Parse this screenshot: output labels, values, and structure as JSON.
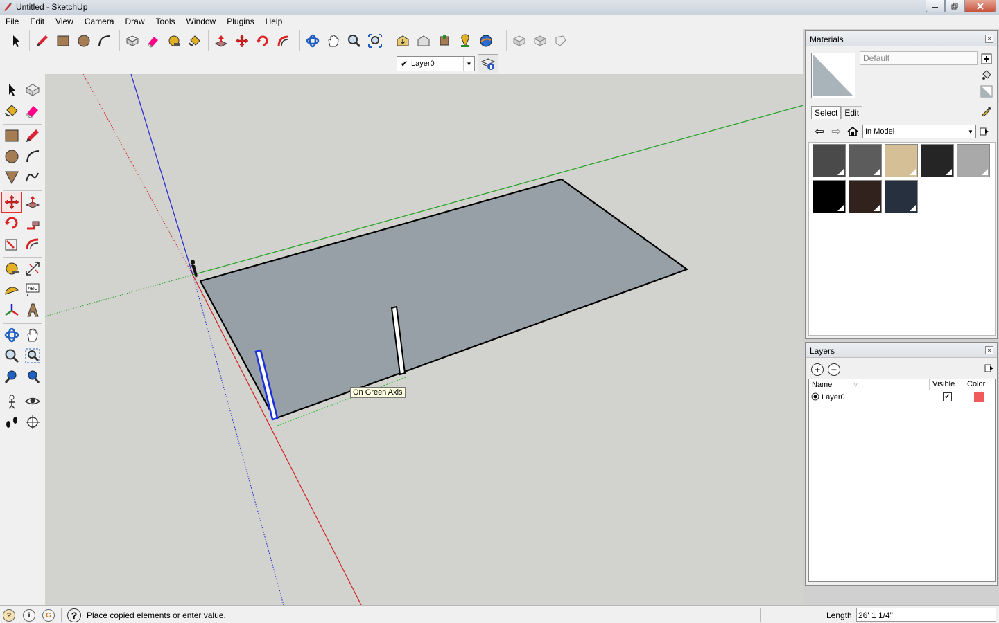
{
  "window": {
    "title": "Untitled - SketchUp"
  },
  "menu": [
    "File",
    "Edit",
    "View",
    "Camera",
    "Draw",
    "Tools",
    "Window",
    "Plugins",
    "Help"
  ],
  "layer_toolbar": {
    "current_layer": "Layer0"
  },
  "viewport": {
    "inference_tooltip": "On Green Axis"
  },
  "status": {
    "message": "Place copied elements or enter value.",
    "length_label": "Length",
    "length_value": "26' 1 1/4\""
  },
  "materials": {
    "title": "Materials",
    "name_placeholder": "Default",
    "tabs": [
      "Select",
      "Edit"
    ],
    "collection": "In Model",
    "swatches": [
      {
        "color": "#4a4a4a"
      },
      {
        "color": "#5c5c5c"
      },
      {
        "color": "#d4bf96"
      },
      {
        "color": "#252525"
      },
      {
        "color": "#a9a9a9"
      },
      {
        "color": "#000000"
      },
      {
        "color": "#31221e"
      },
      {
        "color": "#27303f"
      }
    ]
  },
  "layers": {
    "title": "Layers",
    "columns": {
      "name": "Name",
      "visible": "Visible",
      "color": "Color"
    },
    "rows": [
      {
        "name": "Layer0",
        "visible": true,
        "color": "#f05a5a"
      }
    ]
  },
  "colors": {
    "face": "#96a0a6",
    "red_axis": "#d22020",
    "green_axis": "#20a020",
    "blue_axis": "#2020d0",
    "selection": "#1a2fe0"
  }
}
